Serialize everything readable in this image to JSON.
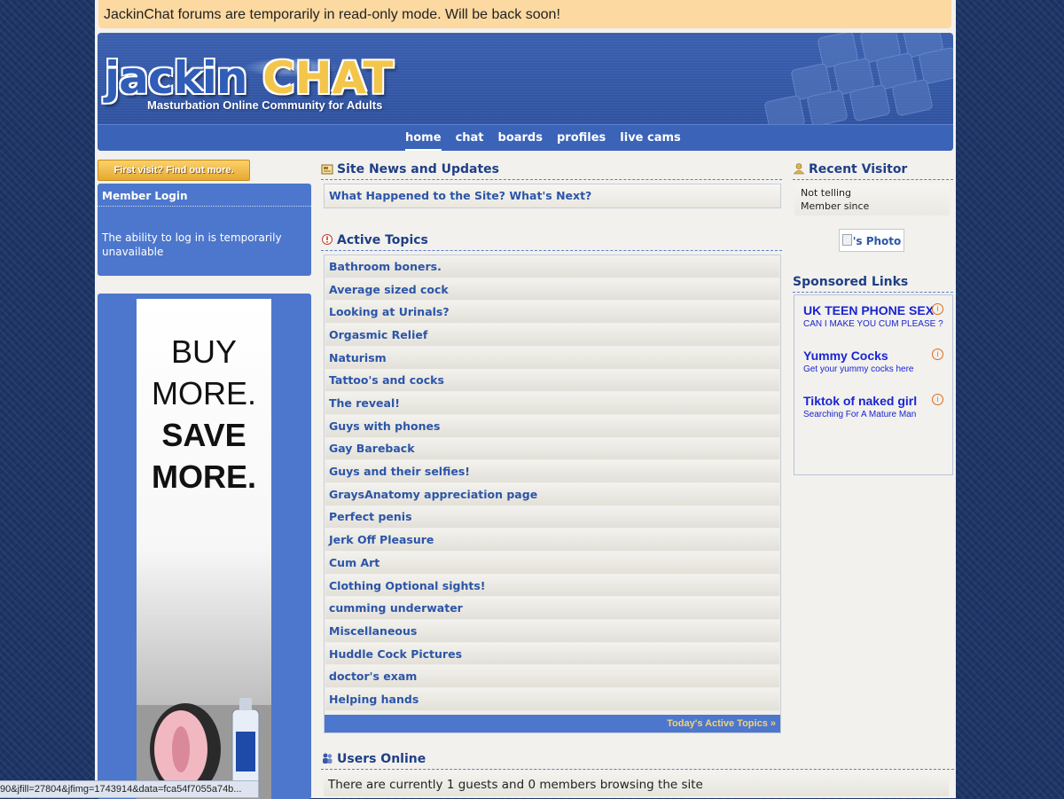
{
  "notice": "JackinChat forums are temporarily in read-only mode. Will be back soon!",
  "logo": {
    "jackin": "jackin",
    "chat": "CHAT",
    "tagline": "Masturbation Online Community for Adults"
  },
  "nav": [
    {
      "label": "home",
      "active": true
    },
    {
      "label": "chat",
      "active": false
    },
    {
      "label": "boards",
      "active": false
    },
    {
      "label": "profiles",
      "active": false
    },
    {
      "label": "live cams",
      "active": false
    }
  ],
  "left": {
    "first_visit": "First visit? Find out more.",
    "login_title": "Member Login",
    "login_text": "The ability to log in is temporarily unavailable",
    "ad_lines": [
      "BUY",
      "MORE.",
      "SAVE",
      "MORE."
    ]
  },
  "status_url": "90&jfill=27804&jfimg=1743914&data=fca54f7055a74b...",
  "news": {
    "title": "Site News and Updates",
    "item": "What Happened to the Site? What's Next?"
  },
  "active_topics": {
    "title": "Active Topics",
    "items": [
      "Bathroom boners.",
      "Average sized cock",
      "Looking at Urinals?",
      "Orgasmic Relief",
      "Naturism",
      "Tattoo's and cocks",
      "The reveal!",
      "Guys with phones",
      "Gay Bareback",
      "Guys and their selfies!",
      "GraysAnatomy appreciation page",
      "Perfect penis",
      "Jerk Off Pleasure",
      "Cum Art",
      "Clothing Optional sights!",
      "cumming underwater",
      "Miscellaneous",
      "Huddle Cock Pictures",
      "doctor's exam",
      "Helping hands"
    ],
    "footer_link": "Today's Active Topics »"
  },
  "users_online": {
    "title": "Users Online",
    "text": "There are currently 1 guests and 0 members browsing the site"
  },
  "recent_visitor": {
    "title": "Recent Visitor",
    "line1": "Not telling",
    "line2": "Member since",
    "photo": "'s Photo"
  },
  "sponsored": {
    "title": "Sponsored Links",
    "links": [
      {
        "title": "UK TEEN PHONE SEX",
        "sub": "CAN I MAKE YOU CUM PLEASE ?"
      },
      {
        "title": "Yummy Cocks",
        "sub": "Get your yummy cocks here"
      },
      {
        "title": "Tiktok of naked girl",
        "sub": "Searching For A Mature Man"
      }
    ]
  },
  "colors": {
    "background": "#1d3566",
    "accent_blue": "#4d77cc",
    "link": "#2c55a8",
    "notice_bg": "#fbd9a1",
    "sponsor_link": "#1a24d2"
  }
}
